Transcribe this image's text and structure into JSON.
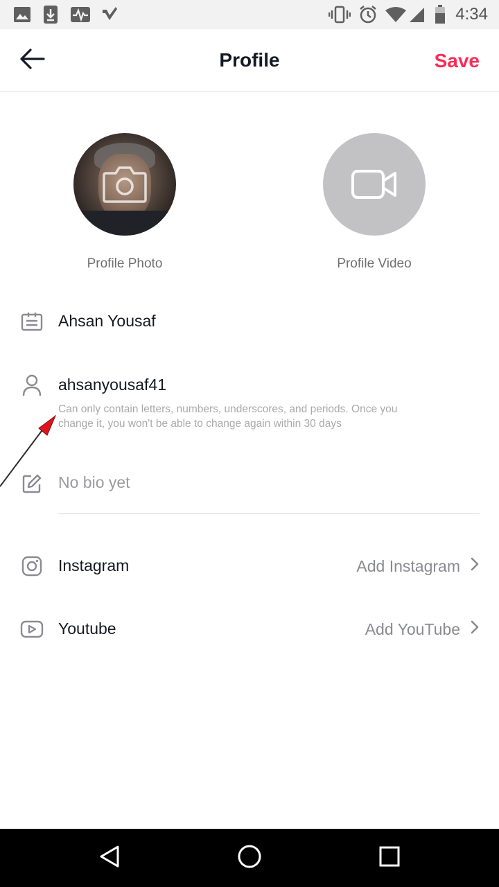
{
  "status_bar": {
    "time": "4:34",
    "left_icons": [
      "image-icon",
      "download-icon",
      "activity-icon",
      "check-badge-icon"
    ],
    "right_icons": [
      "vibrate-icon",
      "alarm-icon",
      "wifi-icon",
      "signal-icon",
      "battery-icon"
    ]
  },
  "header": {
    "title": "Profile",
    "save_label": "Save",
    "accent_color": "#fe2c55"
  },
  "media": {
    "photo_label": "Profile Photo",
    "video_label": "Profile Video"
  },
  "fields": {
    "name": "Ahsan Yousaf",
    "username": "ahsanyousaf41",
    "username_hint_line1": "Can only contain letters, numbers, underscores, and periods. Once you",
    "username_hint_line2": "change it, you won't be able to change again within 30 days",
    "bio_placeholder": "No bio yet"
  },
  "social": {
    "instagram_label": "Instagram",
    "instagram_action": "Add Instagram",
    "youtube_label": "Youtube",
    "youtube_action": "Add YouTube"
  },
  "nav": {
    "icons": [
      "back-nav-icon",
      "home-nav-icon",
      "recents-nav-icon"
    ]
  }
}
